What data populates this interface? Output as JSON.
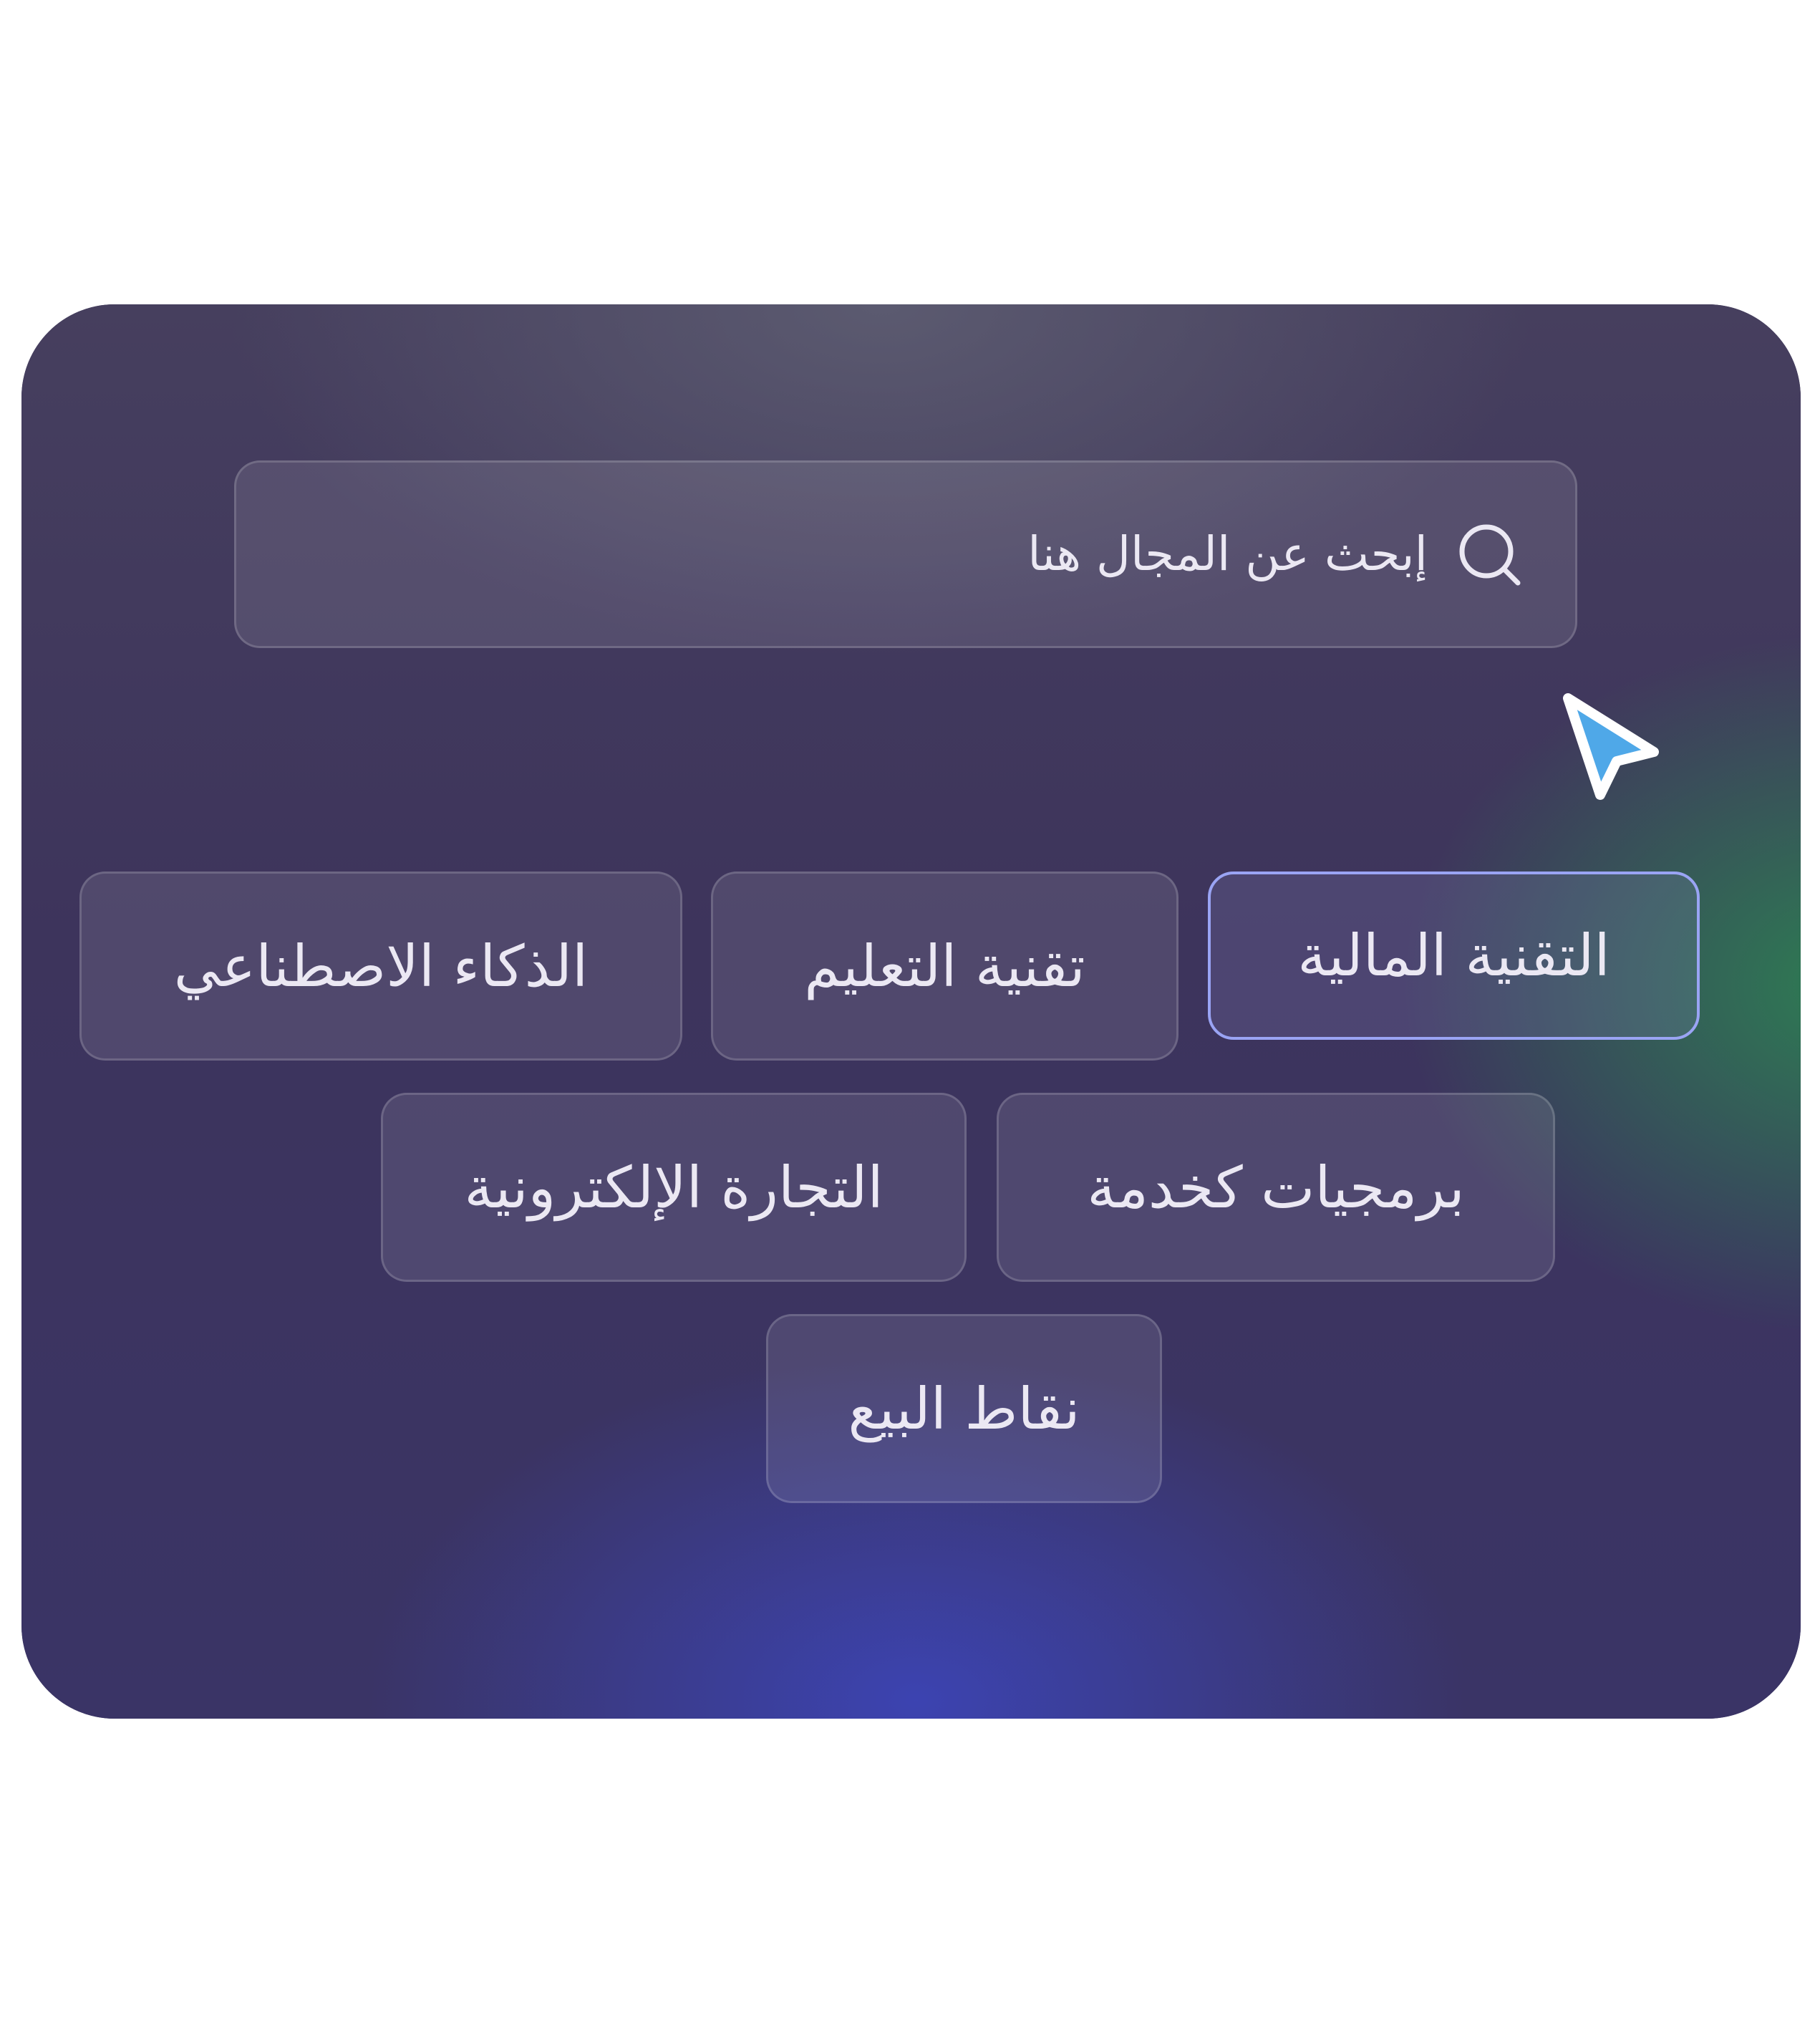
{
  "search": {
    "placeholder": "إبحث عن المجال هنا"
  },
  "chips": [
    {
      "label": "التقنية المالية",
      "selected": true
    },
    {
      "label": "تقنية التعليم",
      "selected": false
    },
    {
      "label": "الذكاء الاصطناعي",
      "selected": false
    },
    {
      "label": "برمجيات كخدمة",
      "selected": false
    },
    {
      "label": "التجارة الإلكترونية",
      "selected": false
    },
    {
      "label": "نقاط البيع",
      "selected": false
    }
  ],
  "colors": {
    "accent": "#9aa4f4",
    "cursor": "#4fa8e8",
    "text": "#ebe8f3"
  }
}
